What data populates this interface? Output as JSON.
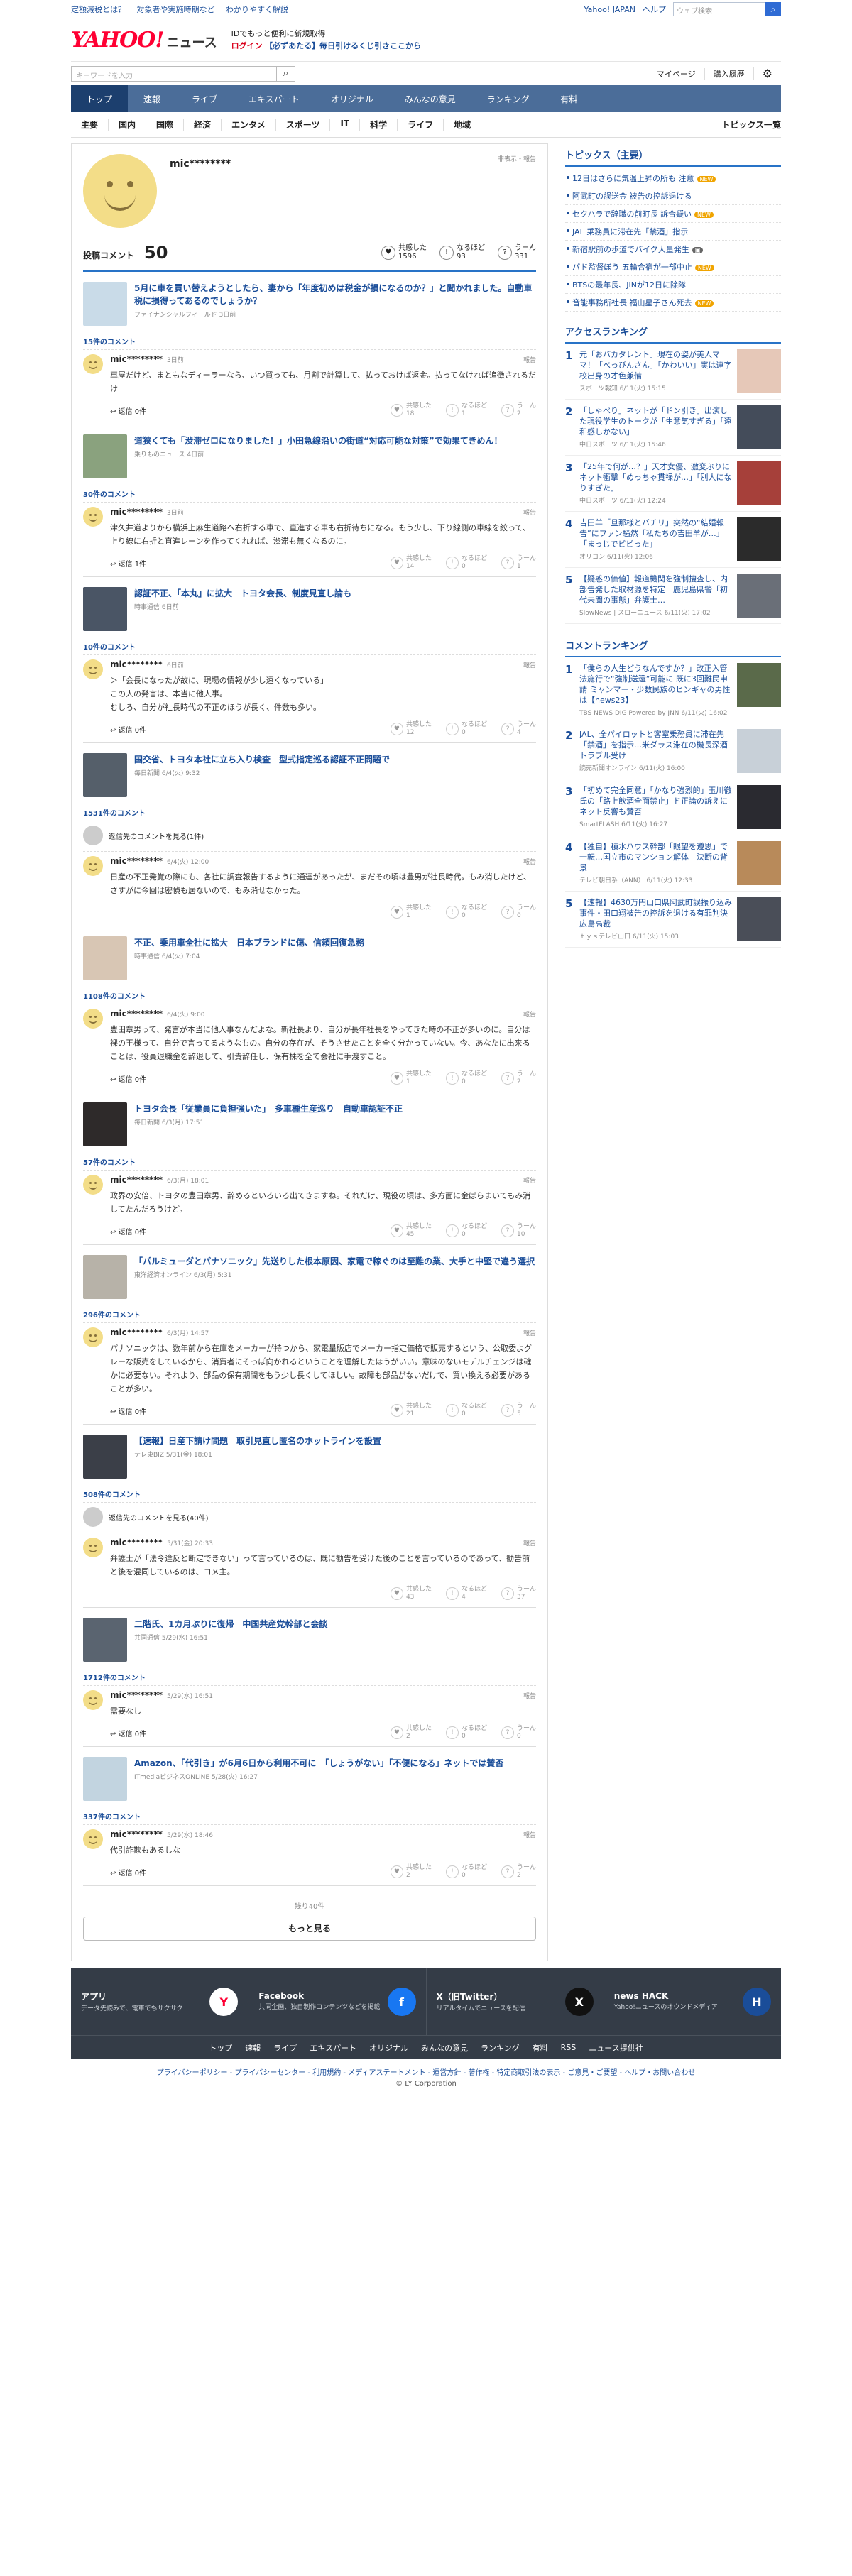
{
  "topbar": {
    "links": [
      "定額減税とは？",
      "対象者や実施時期など",
      "わかりやすく解説"
    ],
    "right": [
      "Yahoo! JAPAN",
      "ヘルプ"
    ],
    "search_placeholder": "ウェブ検索"
  },
  "header": {
    "logo": "YAHOO!",
    "logo_sub": "JAPAN",
    "service": "ニュース",
    "promo1": "IDでもっと便利に新規取得",
    "promo1_bold": "新規取得",
    "promo2": "ログイン",
    "promo3": "【必ずあたる】毎日引けるくじ引きここから"
  },
  "search": {
    "placeholder": "キーワードを入力",
    "mypage": "マイページ",
    "history": "購入履歴"
  },
  "mainnav": [
    "トップ",
    "速報",
    "ライブ",
    "エキスパート",
    "オリジナル",
    "みんなの意見",
    "ランキング",
    "有料"
  ],
  "subnav": {
    "items": [
      "主要",
      "国内",
      "国際",
      "経済",
      "エンタメ",
      "スポーツ",
      "IT",
      "科学",
      "ライフ",
      "地域"
    ],
    "all": "トピックス一覧"
  },
  "profile": {
    "name": "mic********",
    "tools": "非表示・報告",
    "count_label": "投稿コメント",
    "count": "50",
    "reactions": [
      {
        "label": "共感した",
        "value": "1596"
      },
      {
        "label": "なるほど",
        "value": "93"
      },
      {
        "label": "うーん",
        "value": "331"
      }
    ]
  },
  "cards": [
    {
      "title": "5月に車を買い替えようとしたら、妻から「年度初めは税金が損になるのか？」と聞かれました。自動車税に損得ってあるのでしょうか？",
      "source": "ファイナンシャルフィールド 3日前",
      "count": "15件のコメント",
      "user": "mic********",
      "date": "3日前",
      "text": "車屋だけど、まともなディーラーなら、いつ買っても、月割で計算して、払っておけば返金。払ってなければ追徴されるだけ",
      "reply": "返信 0件",
      "r": [
        "18",
        "1",
        "2"
      ],
      "thumb": "#c9dbe8",
      "more": ""
    },
    {
      "title": "道狭くても「渋滞ゼロになりました！」小田急線沿いの街道“対応可能な対策”で効果てきめん！",
      "source": "乗りものニュース 4日前",
      "count": "30件のコメント",
      "user": "mic********",
      "date": "3日前",
      "text": "津久井道よりから横浜上麻生道路へ右折する車で、直進する車も右折待ちになる。もう少し、下り線側の車線を絞って、上り線に右折と直進レーンを作ってくれれば、渋滞も無くなるのに。",
      "reply": "返信 1件",
      "r": [
        "14",
        "0",
        "1"
      ],
      "thumb": "#8aa27e",
      "more": ""
    },
    {
      "title": "認証不正、「本丸」に拡大　トヨタ会長、制度見直し論も",
      "source": "時事通信 6日前",
      "count": "10件のコメント",
      "user": "mic********",
      "date": "6日前",
      "text": "＞「会長になったが故に、現場の情報が少し遠くなっている」\nこの人の発言は、本当に他人事。\nむしろ、自分が社長時代の不正のほうが長く、件数も多い。",
      "reply": "返信 0件",
      "r": [
        "12",
        "0",
        "4"
      ],
      "thumb": "#4a5565",
      "more": ""
    },
    {
      "title": "国交省、トヨタ本社に立ち入り検査　型式指定巡る認証不正問題で",
      "source": "毎日新聞 6/4(火) 9:32",
      "count": "1531件のコメント",
      "user": "mic********",
      "date": "6/4(火) 12:00",
      "text": "日産の不正発覚の際にも、各社に調査報告するように通達があったが、まだその頃は豊男が社長時代。もみ消したけど、さすがに今回は密偵も居ないので、もみ消せなかった。",
      "reply": "",
      "r": [
        "1",
        "0",
        "0"
      ],
      "thumb": "#555f6a",
      "more": "返信先のコメントを見る(1件)"
    },
    {
      "title": "不正、乗用車全社に拡大　日本ブランドに傷、信頼回復急務",
      "source": "時事通信 6/4(火) 7:04",
      "count": "1108件のコメント",
      "user": "mic********",
      "date": "6/4(火) 9:00",
      "text": "豊田章男って、発言が本当に他人事なんだよな。新社長より、自分が長年社長をやってきた時の不正が多いのに。自分は裸の王様って、自分で言ってるようなもの。自分の存在が、そうさせたことを全く分かっていない。今、あなたに出来ることは、役員退職金を辞退して、引責辞任し、保有株を全て会社に手渡すこと。",
      "reply": "返信 0件",
      "r": [
        "1",
        "0",
        "2"
      ],
      "thumb": "#d8c6b4",
      "more": ""
    },
    {
      "title": "トヨタ会長「従業員に負担強いた」　多車種生産巡り　自動車認証不正",
      "source": "毎日新聞 6/3(月) 17:51",
      "count": "57件のコメント",
      "user": "mic********",
      "date": "6/3(月) 18:01",
      "text": "政界の安倍、トヨタの豊田章男、辞めるといろいろ出てきますね。それだけ、現役の頃は、多方面に金ばらまいてもみ消してたんだろうけど。",
      "reply": "返信 0件",
      "r": [
        "45",
        "0",
        "10"
      ],
      "thumb": "#2e2a2a",
      "more": ""
    },
    {
      "title": "「パルミューダとパナソニック」先送りした根本原因、家電で稼ぐのは至難の業、大手と中堅で違う選択",
      "source": "東洋経済オンライン 6/3(月) 5:31",
      "count": "296件のコメント",
      "user": "mic********",
      "date": "6/3(月) 14:57",
      "text": "パナソニックは、数年前から在庫をメーカーが持つから、家電量販店でメーカー指定価格で販売するという、公取委よグレーな販売をしているから、消費者にそっぽ向かれるということを理解したほうがいい。意味のないモデルチェンジは確かに必要ない。それより、部品の保有期間をもう少し長くしてほしい。故障も部品がないだけで、買い換える必要があることが多い。",
      "reply": "返信 0件",
      "r": [
        "21",
        "0",
        "5"
      ],
      "thumb": "#b7b2a8",
      "more": ""
    },
    {
      "title": "【速報】日産下請け問題　取引見直し匿名のホットラインを設置",
      "source": "テレ東BIZ 5/31(金) 18:01",
      "count": "508件のコメント",
      "user": "mic********",
      "date": "5/31(金) 20:33",
      "text": "弁護士が「法令違反と断定できない」って言っているのは、既に勧告を受けた後のことを言っているのであって、勧告前と後を混同しているのは、コメ主。",
      "reply": "",
      "r": [
        "43",
        "4",
        "37"
      ],
      "thumb": "#3b3f48",
      "more": "返信先のコメントを見る(40件)"
    },
    {
      "title": "二階氏、1カ月ぶりに復帰　中国共産党幹部と会談",
      "source": "共同通信 5/29(水) 16:51",
      "count": "1712件のコメント",
      "user": "mic********",
      "date": "5/29(水) 16:51",
      "text": "需要なし",
      "reply": "返信 0件",
      "r": [
        "2",
        "0",
        "0"
      ],
      "thumb": "#5a6470",
      "more": ""
    },
    {
      "title": "Amazon、「代引き」が6月6日から利用不可に　「しょうがない」「不便になる」ネットでは賛否",
      "source": "ITmediaビジネスONLINE 5/28(火) 16:27",
      "count": "337件のコメント",
      "user": "mic********",
      "date": "5/29(水) 18:46",
      "text": "代引詐欺もあるしな",
      "reply": "返信 0件",
      "r": [
        "2",
        "0",
        "2"
      ],
      "thumb": "#c2d4e0",
      "more": ""
    }
  ],
  "more": {
    "remaining": "残り40件",
    "label": "もっと見る"
  },
  "topics": {
    "title": "トピックス（主要）",
    "items": [
      {
        "t": "12日はさらに気温上昇の所も 注意",
        "b": "NEW"
      },
      {
        "t": "阿武町の誤送金 被告の控訴退ける",
        "b": ""
      },
      {
        "t": "セクハラで辞職の前町長 訴合疑い",
        "b": "NEW"
      },
      {
        "t": "JAL 乗務員に滞在先「禁酒」指示",
        "b": ""
      },
      {
        "t": "新宿駅前の歩道でバイク大量発生",
        "b": "IMG"
      },
      {
        "t": "パド監督ぼう 五輪合宿が一部中止",
        "b": "NEW"
      },
      {
        "t": "BTSの最年長、JINが12日に除隊",
        "b": ""
      },
      {
        "t": "音能事務所社長 福山星子さん死去",
        "b": "NEW"
      }
    ]
  },
  "access": {
    "title": "アクセスランキング",
    "items": [
      {
        "n": "1",
        "t": "元「おバカタレント」現在の姿が美人ママ！「べっぴんさん」「かわいい」実は連字校出身の才色兼備",
        "s": "スポーツ報知 6/11(火) 15:15",
        "c": "#e6c8b8"
      },
      {
        "n": "2",
        "t": "「しゃべり」ネットが「ドン引き」出演した現役学生のトークが「生意気すぎる」「遠和感しかない」",
        "s": "中日スポーツ 6/11(火) 15:46",
        "c": "#444c5a"
      },
      {
        "n": "3",
        "t": "「25年で何が…？」天才女優、激変ぶりにネット衝撃「めっちゃ貫禄が…」「別人になりすぎた」",
        "s": "中日スポーツ 6/11(火) 12:24",
        "c": "#a6403a"
      },
      {
        "n": "4",
        "t": "吉田羊「旦那様とバチリ」突然の“結婚報告”にファン騒然「私たちの吉田羊が…」「まっじでビビった」",
        "s": "オリコン 6/11(火) 12:06",
        "c": "#2b2b2b"
      },
      {
        "n": "5",
        "t": "【疑惑の価値】報道機関を強制捜査し、内部告発した取材源を特定　鹿児島県警「初代未聞の事態」弁護士…",
        "s": "SlowNews | スローニュース 6/11(火) 17:02",
        "c": "#6a6f78"
      }
    ]
  },
  "commentrank": {
    "title": "コメントランキング",
    "items": [
      {
        "n": "1",
        "t": "「僕らの人生どうなんですか？」改正入管法施行で“強制送還”可能に 既に3回難民申請 ミャンマー・少数民族のヒンギャの男性は【news23】",
        "s": "TBS NEWS DIG Powered by JNN 6/11(火) 16:02",
        "c": "#5a6a4a"
      },
      {
        "n": "2",
        "t": "JAL、全パイロットと客室乗務員に滞在先「禁酒」を指示…米ダラス滞在の機長深酒トラブル受け",
        "s": "読売新聞オンライン 6/11(火) 16:00",
        "c": "#c8d0d8"
      },
      {
        "n": "3",
        "t": "「初めて完全同意」「かなり強烈的」玉川徹氏の「路上飲酒全面禁止」ド正論の訴えにネット反響も賛否",
        "s": "SmartFLASH 6/11(火) 16:27",
        "c": "#2a2a30"
      },
      {
        "n": "4",
        "t": "【独自】積水ハウス幹部「眼望を遵思」で一転…国立市のマンション解体　決断の背景",
        "s": "テレビ朝日系（ANN） 6/11(火) 12:33",
        "c": "#b88a5a"
      },
      {
        "n": "5",
        "t": "【速報】4630万円山口県阿武町誤振り込み事件・田口翔被告の控訴を退ける有罪判決　広島高裁",
        "s": "ｔｙｓテレビ山口 6/11(火) 15:03",
        "c": "#4a4e58"
      }
    ]
  },
  "footer": {
    "cells": [
      {
        "t": "アプリ",
        "d": "データ先読みで、電車でもサクサク",
        "ic": "Y",
        "col": "#ff0033",
        "bg": "#fff"
      },
      {
        "t": "Facebook",
        "d": "共同企画、独自制作コンテンツなどを掲載",
        "ic": "f",
        "col": "#fff",
        "bg": "#1877f2"
      },
      {
        "t": "X（旧Twitter）",
        "d": "リアルタイムでニュースを配信",
        "ic": "X",
        "col": "#fff",
        "bg": "#111"
      },
      {
        "t": "news HACK",
        "d": "Yahoo!ニュースのオウンドメディア",
        "ic": "H",
        "col": "#fff",
        "bg": "#1a4d99"
      }
    ],
    "nav": [
      "トップ",
      "速報",
      "ライブ",
      "エキスパート",
      "オリジナル",
      "みんなの意見",
      "ランキング",
      "有料",
      "RSS",
      "ニュース提供社"
    ],
    "links": "プライバシーポリシー - プライバシーセンター - 利用規約 - メディアステートメント - 運営方針 - 著作権 - 特定商取引法の表示 - ご意見・ご要望 - ヘルプ・お問い合わせ",
    "copy": "© LY Corporation"
  }
}
